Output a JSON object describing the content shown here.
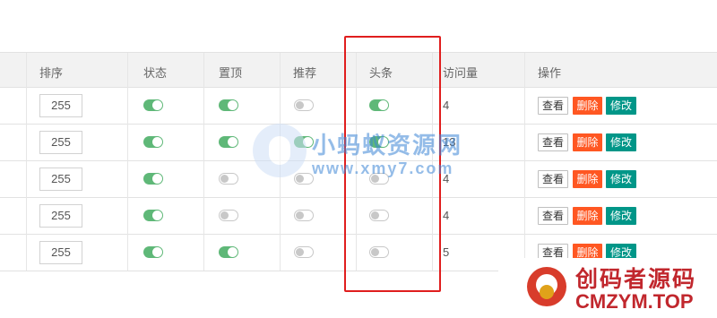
{
  "columns": {
    "sort": "排序",
    "status": "状态",
    "top": "置顶",
    "recommend": "推荐",
    "headline": "头条",
    "visits": "访问量",
    "actions": "操作"
  },
  "rows": [
    {
      "sort": "255",
      "status": true,
      "top": true,
      "recommend": false,
      "headline": true,
      "visits": "4"
    },
    {
      "sort": "255",
      "status": true,
      "top": true,
      "recommend": true,
      "headline": true,
      "visits": "13"
    },
    {
      "sort": "255",
      "status": true,
      "top": false,
      "recommend": false,
      "headline": false,
      "visits": "4"
    },
    {
      "sort": "255",
      "status": true,
      "top": false,
      "recommend": false,
      "headline": false,
      "visits": "4"
    },
    {
      "sort": "255",
      "status": true,
      "top": true,
      "recommend": false,
      "headline": false,
      "visits": "5"
    }
  ],
  "buttons": {
    "view": "查看",
    "delete": "删除",
    "edit": "修改"
  },
  "colors": {
    "switch_on": "#5fb878",
    "delete": "#ff5722",
    "edit": "#009688",
    "highlight": "#e01e1e"
  },
  "watermark": {
    "cn": "小蚂蚁资源网",
    "url": "www.xmy7.com"
  },
  "badge": {
    "cn": "创码者源码",
    "en": "CMZYM.TOP"
  }
}
